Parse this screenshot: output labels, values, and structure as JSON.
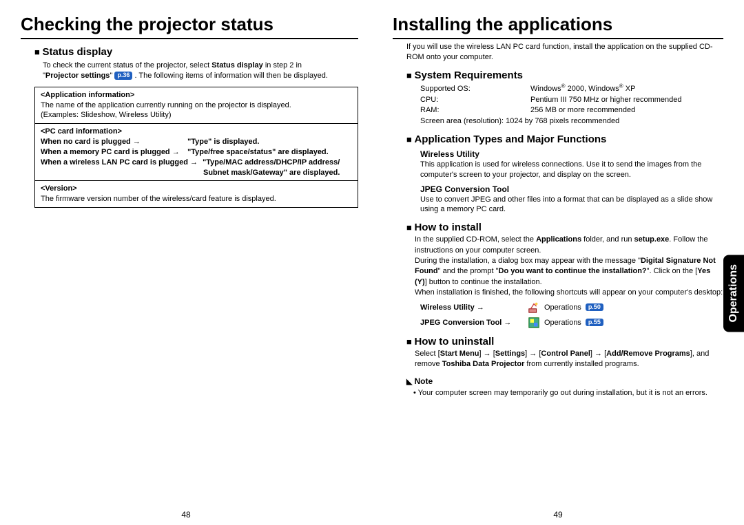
{
  "left": {
    "title": "Checking the projector status",
    "status_heading": "Status display",
    "status_intro_1": "To check the current status of the projector, select ",
    "status_intro_bold": "Status display",
    "status_intro_2": " in step 2 in",
    "status_intro_3": "\"",
    "status_intro_bold2": "Projector settings",
    "status_intro_4": "\" ",
    "status_page_ref": "p.36",
    "status_intro_5": " . The following items of information will then be displayed.",
    "box1_title": "<Application information>",
    "box1_line1": "The name of the application currently running on the projector is displayed.",
    "box1_line2": "(Examples: Slideshow, Wireless Utility)",
    "box2_title": "<PC card information>",
    "box2_l1a": "When no card is plugged →",
    "box2_l1b": "\"Type\" is displayed.",
    "box2_l2a": "When a memory PC card is plugged →",
    "box2_l2b": "\"Type/free space/status\" are displayed.",
    "box2_l3a": "When a wireless LAN PC card is plugged →",
    "box2_l3b": "\"Type/MAC address/DHCP/IP address/",
    "box2_l4": "Subnet mask/Gateway\" are displayed.",
    "box3_title": "<Version>",
    "box3_line1": "The firmware version number of the wireless/card feature is displayed."
  },
  "right": {
    "title": "Installing the applications",
    "intro": "If you will use the wireless LAN PC card function, install the application on the supplied CD-ROM onto your computer.",
    "sysreq_heading": "System Requirements",
    "sysreq": {
      "os_label": "Supported OS:",
      "os_value_pre": "Windows",
      "os_value_mid": " 2000, Windows",
      "os_value_end": " XP",
      "cpu_label": "CPU:",
      "cpu_value": "Pentium III 750 MHz or higher recommended",
      "ram_label": "RAM:",
      "ram_value": "256 MB or more recommended",
      "screen_full": "Screen area (resolution): 1024 by 768 pixels recommended"
    },
    "apps_heading": "Application Types and Major Functions",
    "wireless_title": "Wireless Utility",
    "wireless_text": "This application is used for wireless connections. Use it to send the images from the computer's screen to your projector, and display on the screen.",
    "jpeg_title": "JPEG Conversion Tool",
    "jpeg_text": "Use to convert JPEG and other files into a format that can be displayed as a slide show using a memory PC card.",
    "install_heading": "How to install",
    "install_p1_a": "In the supplied CD-ROM, select the ",
    "install_p1_b": "Applications",
    "install_p1_c": " folder, and run ",
    "install_p1_d": "setup.exe",
    "install_p1_e": ". Follow the instructions on your computer screen.",
    "install_p2_a": "During the installation, a dialog box may appear with the message \"",
    "install_p2_b": "Digital Signature Not Found",
    "install_p2_c": "\" and the prompt \"",
    "install_p2_d": "Do you want to continue the installation?",
    "install_p2_e": "\". Click on the [",
    "install_p2_f": "Yes (Y)",
    "install_p2_g": "] button to continue the installation.",
    "install_p3": "When installation is finished, the following shortcuts will appear on your computer's desktop:",
    "shortcut1_label": "Wireless Utility →",
    "shortcut1_ops": "Operations",
    "shortcut1_ref": "p.50",
    "shortcut2_label": "JPEG Conversion Tool →",
    "shortcut2_ops": "Operations",
    "shortcut2_ref": "p.55",
    "uninstall_heading": "How to uninstall",
    "uninstall_a": "Select [",
    "uninstall_b": "Start Menu",
    "uninstall_c": "] → [",
    "uninstall_d": "Settings",
    "uninstall_e": "] → [",
    "uninstall_f": "Control Panel",
    "uninstall_g": "] → [",
    "uninstall_h": "Add/Remove Programs",
    "uninstall_i": "], and remove ",
    "uninstall_j": "Toshiba Data Projector",
    "uninstall_k": " from currently installed programs.",
    "note_heading": "Note",
    "note_bullet": "• Your computer screen may temporarily go out during installation, but it is not an errors."
  },
  "side_tab": "Operations",
  "page_left": "48",
  "page_right": "49"
}
